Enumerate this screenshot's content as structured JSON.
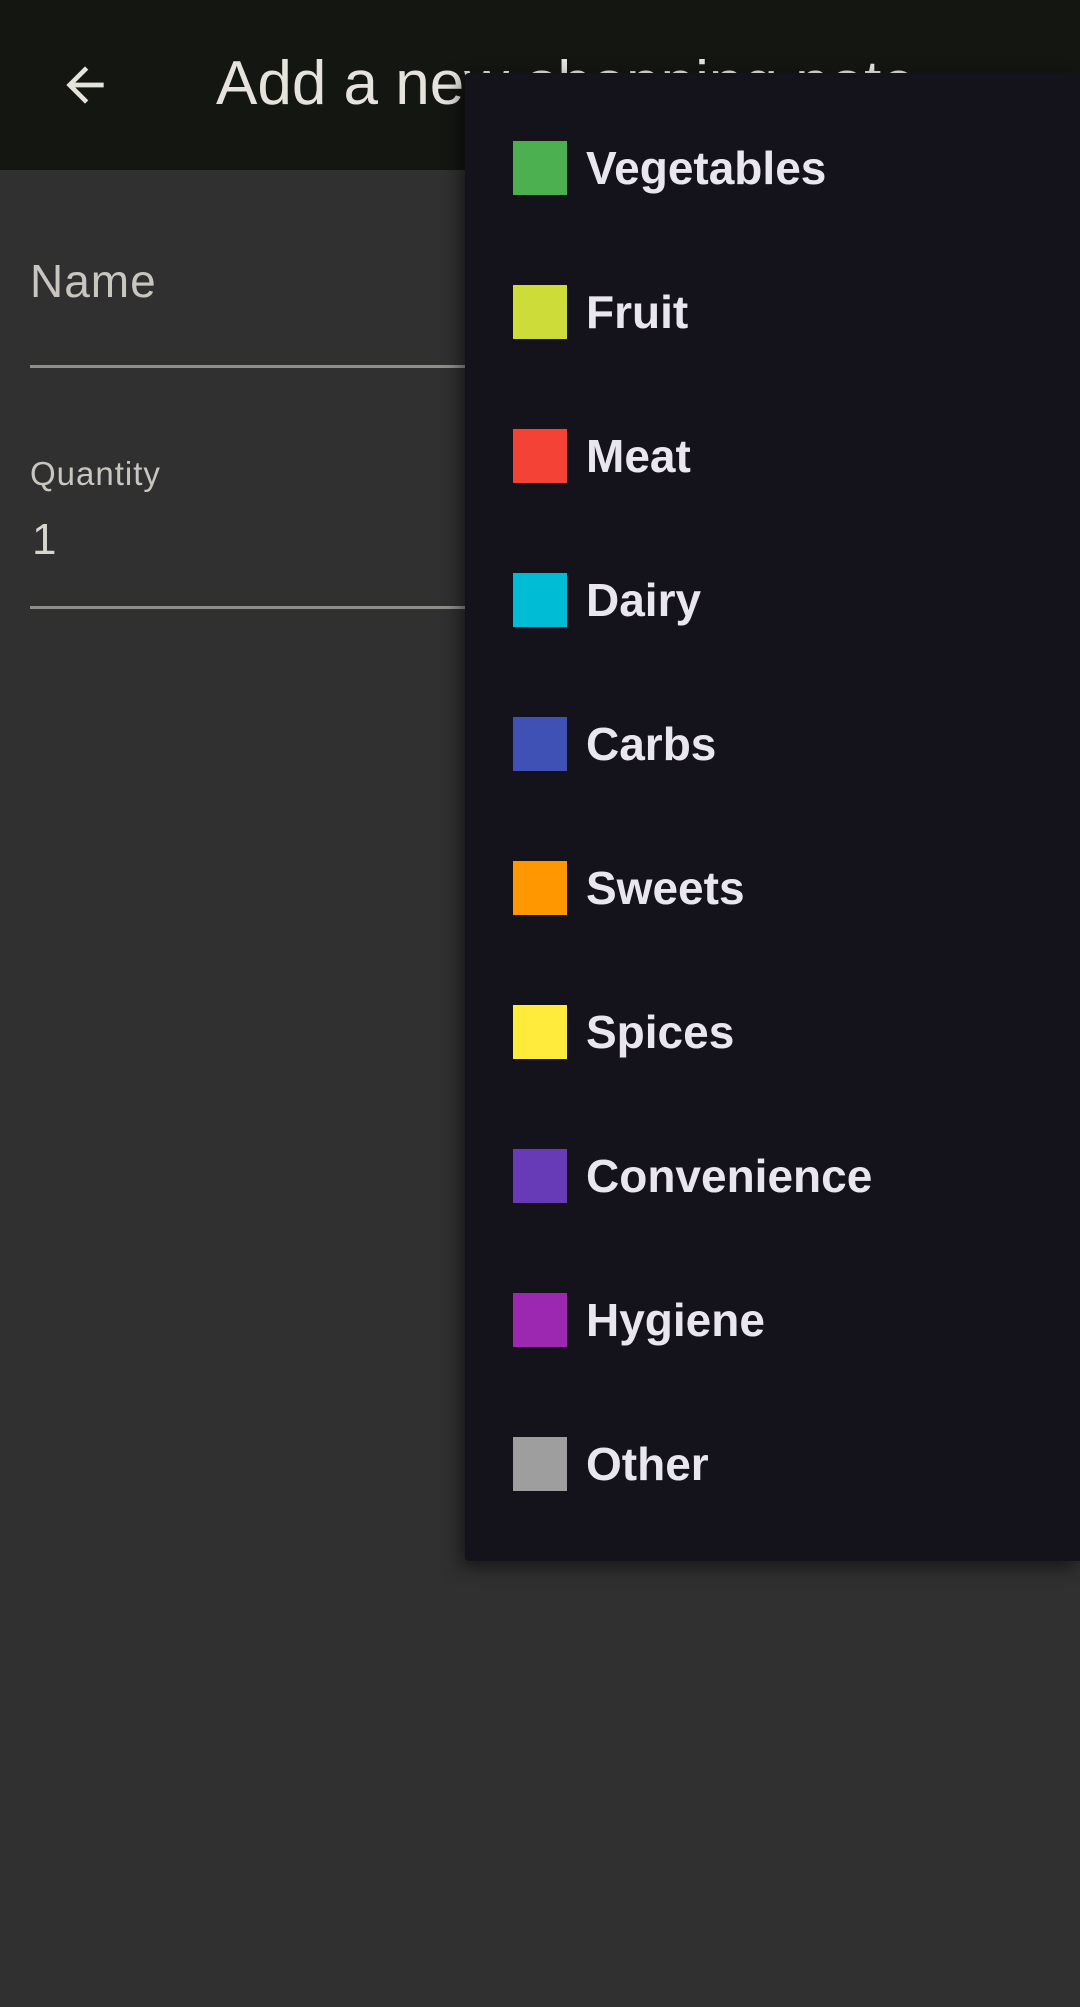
{
  "app_bar": {
    "back_icon": "arrow-left-icon",
    "title": "Add a new shopping note"
  },
  "form": {
    "name_field": {
      "placeholder": "Name",
      "value": ""
    },
    "quantity_field": {
      "label": "Quantity",
      "value": "1"
    }
  },
  "category_menu": {
    "items": [
      {
        "label": "Vegetables",
        "color": "#4caf50"
      },
      {
        "label": "Fruit",
        "color": "#cddc39"
      },
      {
        "label": "Meat",
        "color": "#f44336"
      },
      {
        "label": "Dairy",
        "color": "#00bcd4"
      },
      {
        "label": "Carbs",
        "color": "#3f51b5"
      },
      {
        "label": "Sweets",
        "color": "#ff9800"
      },
      {
        "label": "Spices",
        "color": "#ffeb3b"
      },
      {
        "label": "Convenience",
        "color": "#673ab7"
      },
      {
        "label": "Hygiene",
        "color": "#9c27b0"
      },
      {
        "label": "Other",
        "color": "#9e9e9e"
      }
    ]
  }
}
